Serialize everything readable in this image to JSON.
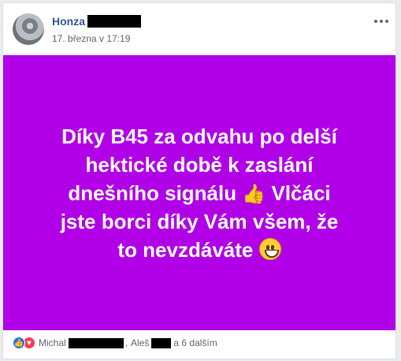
{
  "post": {
    "author": "Honza",
    "timestamp": "17. března v 17:19",
    "text_lines": [
      "Díky B45 za odvahu po delší",
      "hektické době k zaslání",
      "dnešního signálu",
      "Vlčáci",
      "jste borci díky Vám všem, že",
      "to nevzdáváte"
    ],
    "background_color": "#b100e8"
  },
  "reactions": {
    "name1": "Michal",
    "separator": ",",
    "name2": "Aleš",
    "others": "a 6 dalším",
    "icons": [
      "like-icon",
      "love-icon"
    ]
  },
  "icons": {
    "thumb": "👍",
    "heart": "♥",
    "like": "👍"
  }
}
